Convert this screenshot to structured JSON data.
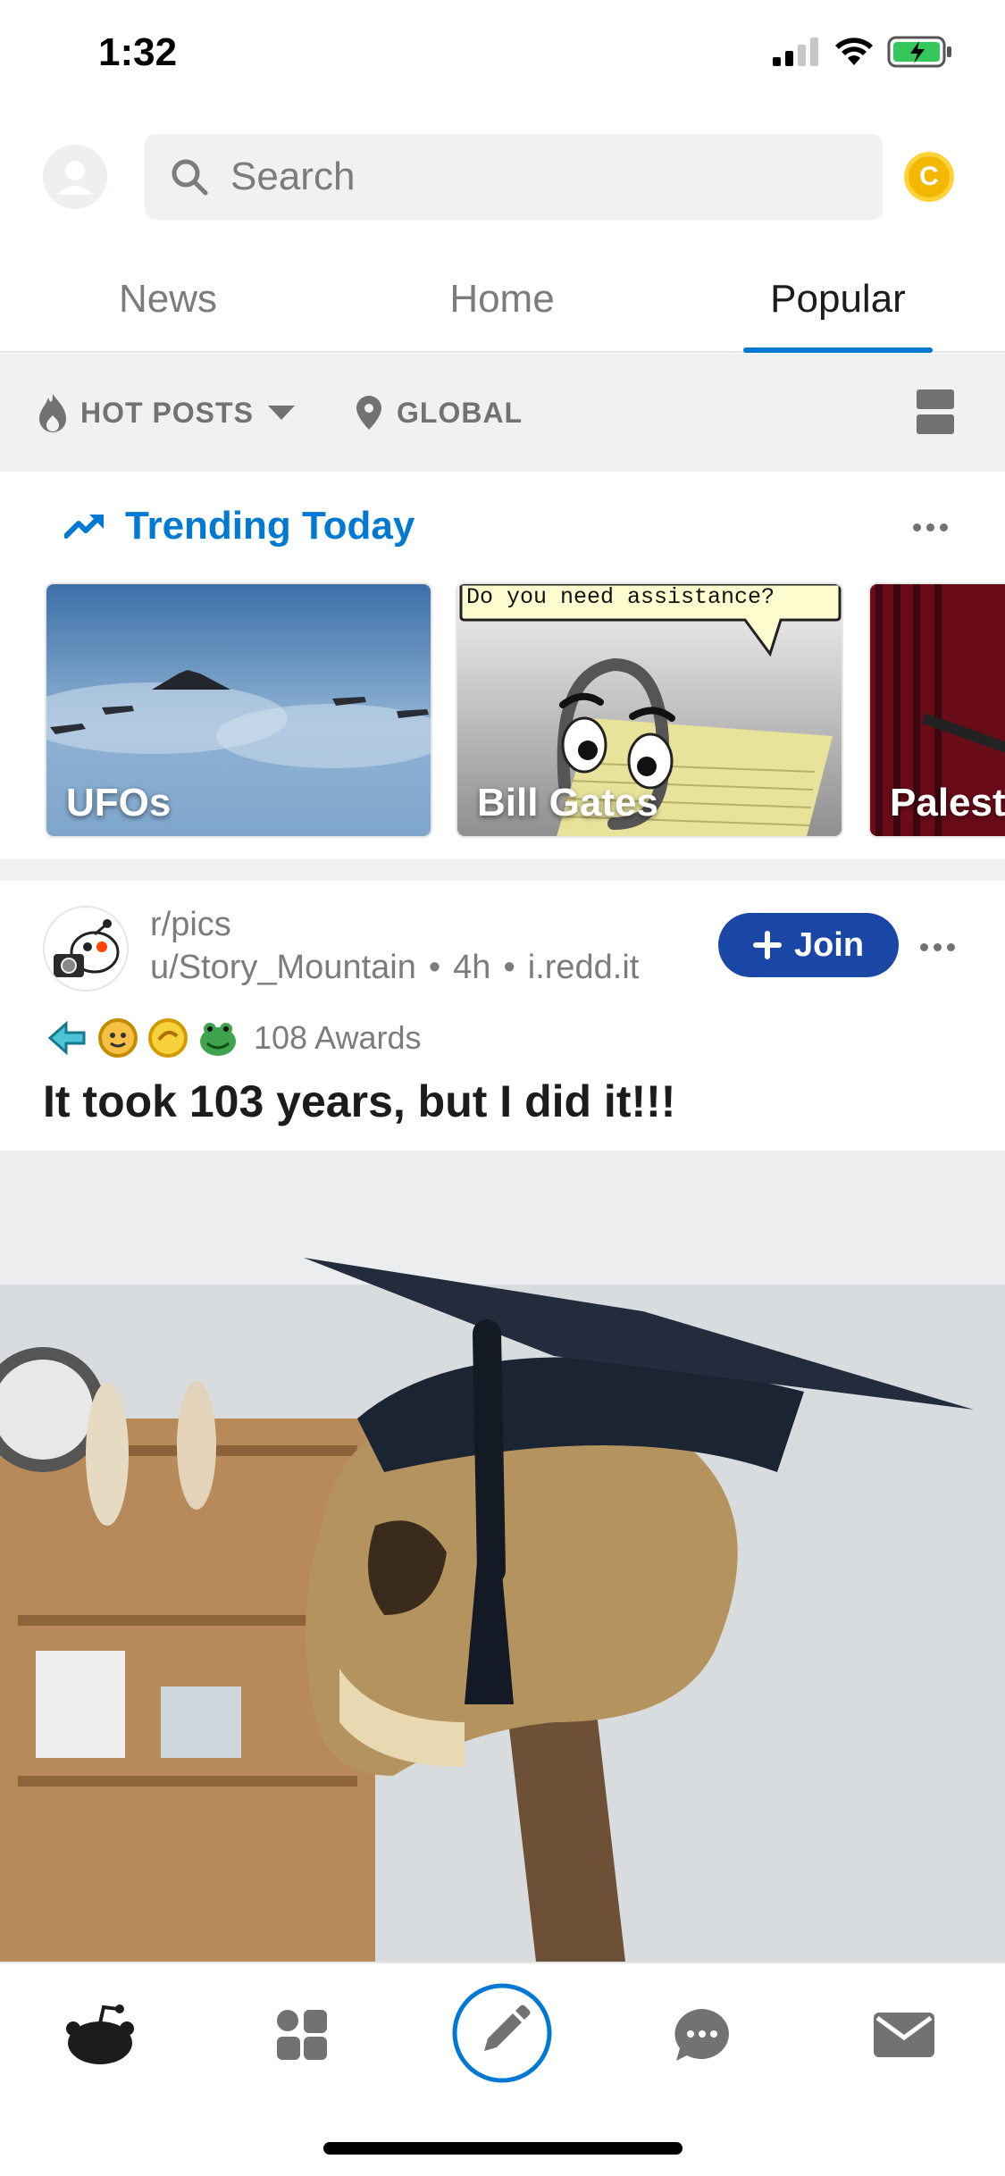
{
  "status_bar": {
    "time": "1:32",
    "icons": [
      "signal-icon",
      "wifi-icon",
      "battery-charging-icon"
    ]
  },
  "header": {
    "search_placeholder": "Search",
    "coin_label": "C"
  },
  "tabs": [
    {
      "label": "News",
      "active": false
    },
    {
      "label": "Home",
      "active": false
    },
    {
      "label": "Popular",
      "active": true
    }
  ],
  "sort_bar": {
    "sort_label": "HOT POSTS",
    "location_label": "GLOBAL"
  },
  "trending": {
    "title": "Trending Today",
    "cards": [
      {
        "label": "UFOs"
      },
      {
        "label": "Bill Gates",
        "speech": "Do you need assistance?"
      },
      {
        "label": "Palest"
      }
    ]
  },
  "post": {
    "subreddit": "r/pics",
    "author": "u/Story_Mountain",
    "age": "4h",
    "domain": "i.redd.it",
    "join_label": "Join",
    "awards_text": "108 Awards",
    "title": "It took 103 years, but I did it!!!"
  },
  "bottom_nav": [
    "home-icon",
    "communities-icon",
    "create-post-icon",
    "chat-icon",
    "inbox-icon"
  ],
  "colors": {
    "accent": "#0079d3",
    "join": "#1a47a5",
    "coin": "#f5b800",
    "muted": "#7c7c7c",
    "separator": "#f0f1f3"
  }
}
